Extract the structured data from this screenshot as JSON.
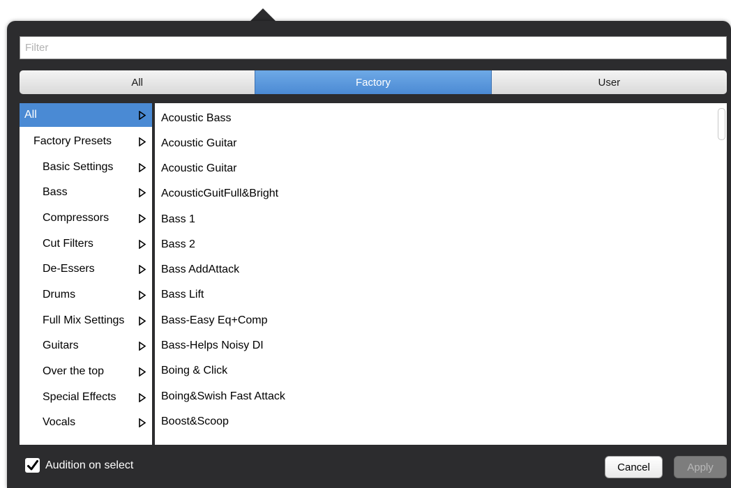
{
  "filter": {
    "placeholder": "Filter",
    "value": ""
  },
  "tabs": [
    {
      "label": "All",
      "active": false
    },
    {
      "label": "Factory",
      "active": true
    },
    {
      "label": "User",
      "active": false
    }
  ],
  "categories": [
    {
      "label": "All",
      "selected": true
    },
    {
      "label": "Factory Presets",
      "selected": false
    },
    {
      "label": "Basic Settings",
      "selected": false
    },
    {
      "label": "Bass",
      "selected": false
    },
    {
      "label": "Compressors",
      "selected": false
    },
    {
      "label": "Cut Filters",
      "selected": false
    },
    {
      "label": "De-Essers",
      "selected": false
    },
    {
      "label": "Drums",
      "selected": false
    },
    {
      "label": "Full Mix Settings",
      "selected": false
    },
    {
      "label": "Guitars",
      "selected": false
    },
    {
      "label": "Over the top",
      "selected": false
    },
    {
      "label": "Special Effects",
      "selected": false
    },
    {
      "label": "Vocals",
      "selected": false
    }
  ],
  "presets": [
    "Acoustic Bass",
    "Acoustic Guitar",
    "Acoustic Guitar",
    "AcousticGuitFull&Bright",
    "Bass 1",
    "Bass 2",
    "Bass AddAttack",
    "Bass Lift",
    "Bass-Easy Eq+Comp",
    "Bass-Helps Noisy DI",
    "Boing & Click",
    "Boing&Swish Fast Attack",
    "Boost&Scoop"
  ],
  "footer": {
    "audition_label": "Audition on select",
    "audition_checked": true,
    "cancel_label": "Cancel",
    "apply_label": "Apply",
    "apply_enabled": false
  },
  "colors": {
    "accent": "#4a8ad4",
    "panel": "#2c2c2e"
  }
}
